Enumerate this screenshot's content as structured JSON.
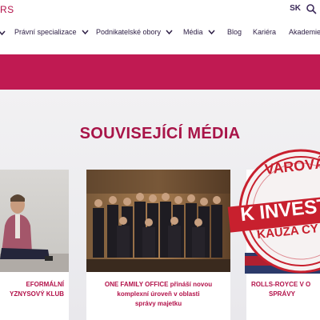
{
  "header": {
    "logo_fragment": "RS",
    "language": "SK"
  },
  "nav": {
    "items": [
      {
        "label": "Právní specializace",
        "has_dropdown": true
      },
      {
        "label": "Podnikatelské obory",
        "has_dropdown": true
      },
      {
        "label": "Média",
        "has_dropdown": true
      },
      {
        "label": "Blog",
        "has_dropdown": false
      },
      {
        "label": "Kariéra",
        "has_dropdown": false
      },
      {
        "label": "Akademie",
        "has_dropdown": false
      }
    ]
  },
  "section": {
    "title": "SOUVISEJÍCÍ MÉDIA"
  },
  "cards": [
    {
      "caption_lines": [
        "EFORMÁLNÍ",
        "YZNYSOVÝ KLUB"
      ]
    },
    {
      "caption_lines": [
        "ONE FAMILY OFFICE přináší novou",
        "komplexní úroveň v oblasti",
        "správy majetku"
      ]
    },
    {
      "caption_lines": [
        "ROLLS-ROYCE V O",
        "SPRÁVY"
      ],
      "stamp_lines": [
        "VAROVÁ",
        "K INVEST",
        "KAUZA CY"
      ]
    }
  ],
  "colors": {
    "brand": "#c01a52",
    "brand_dark": "#a81448",
    "nav_text": "#2f2046",
    "section_bg": "#ececef"
  },
  "icons": {
    "search": "search-icon",
    "dropdown": "chevron-down-icon"
  }
}
